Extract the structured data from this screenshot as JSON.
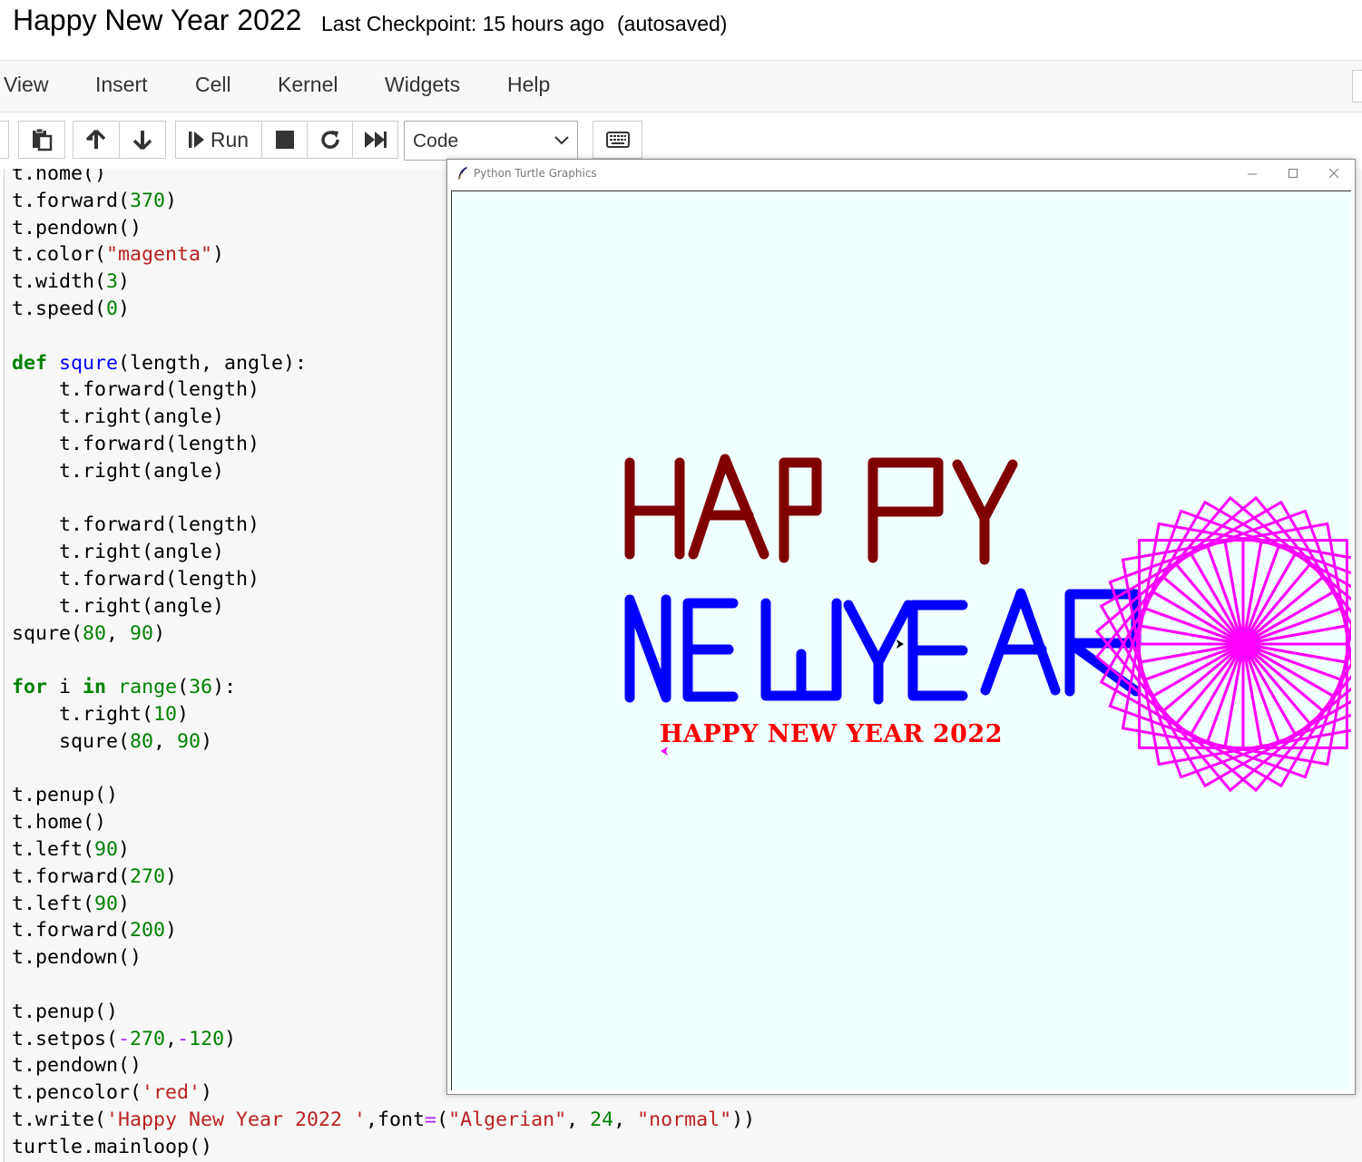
{
  "header": {
    "notebook_title": "Happy New Year 2022",
    "checkpoint": "Last Checkpoint: 15 hours ago",
    "autosave_status": "(autosaved)"
  },
  "menubar": {
    "items": [
      "View",
      "Insert",
      "Cell",
      "Kernel",
      "Widgets",
      "Help"
    ]
  },
  "toolbar": {
    "run_label": "Run",
    "cell_type": "Code",
    "icons": [
      "paste-icon",
      "move-up-icon",
      "move-down-icon",
      "run-icon",
      "stop-icon",
      "restart-icon",
      "fast-forward-icon",
      "keyboard-icon"
    ]
  },
  "code_lines": [
    "t.home()",
    "t.forward(370)",
    "t.pendown()",
    "t.color(\"magenta\")",
    "t.width(3)",
    "t.speed(0)",
    "",
    "def squre(length, angle):",
    "    t.forward(length)",
    "    t.right(angle)",
    "    t.forward(length)",
    "    t.right(angle)",
    "",
    "    t.forward(length)",
    "    t.right(angle)",
    "    t.forward(length)",
    "    t.right(angle)",
    "squre(80, 90)",
    "",
    "for i in range(36):",
    "    t.right(10)",
    "    squre(80, 90)",
    "",
    "t.penup()",
    "t.home()",
    "t.left(90)",
    "t.forward(270)",
    "t.left(90)",
    "t.forward(200)",
    "t.pendown()",
    "",
    "t.penup()",
    "t.setpos(-270,-120)",
    "t.pendown()",
    "t.pencolor('red')",
    "t.write('Happy New Year 2022 ',font=(\"Algerian\", 24, \"normal\"))",
    "turtle.mainloop()"
  ],
  "turtle_window": {
    "title": "Python Turtle Graphics",
    "canvas_background": "#f0ffff",
    "greeting_text": "HAPPY NEW YEAR 2022",
    "colors": {
      "happy": "#800000",
      "new_year": "#0000ff",
      "spiral": "#ff00ff",
      "greeting": "#ff0000"
    }
  }
}
